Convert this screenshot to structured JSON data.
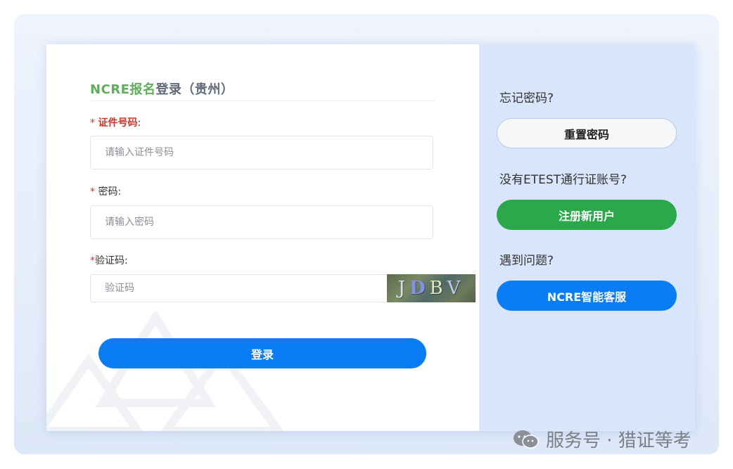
{
  "login": {
    "title_green": "NCRE报名",
    "title_dark": "登录（贵州）",
    "id_label": "证件号码",
    "id_placeholder": "请输入证件号码",
    "password_label": "密码",
    "password_placeholder": "请输入密码",
    "captcha_label": "验证码",
    "captcha_placeholder": "验证码",
    "captcha_text": [
      "J",
      "D",
      "B",
      "V"
    ],
    "submit_label": "登录",
    "required_mark": "*",
    "colon": ":"
  },
  "side": {
    "forgot_text": "忘记密码?",
    "reset_label": "重置密码",
    "no_account_text": "没有ETEST通行证账号?",
    "register_label": "注册新用户",
    "problem_text": "遇到问题?",
    "support_label": "NCRE智能客服"
  },
  "watermark": {
    "text": "服务号 · 猎证等考"
  },
  "colors": {
    "primary": "#0a7df6",
    "success": "#2aa84a",
    "brand_green": "#5fae5a",
    "side_bg": "#d9e5fb"
  }
}
